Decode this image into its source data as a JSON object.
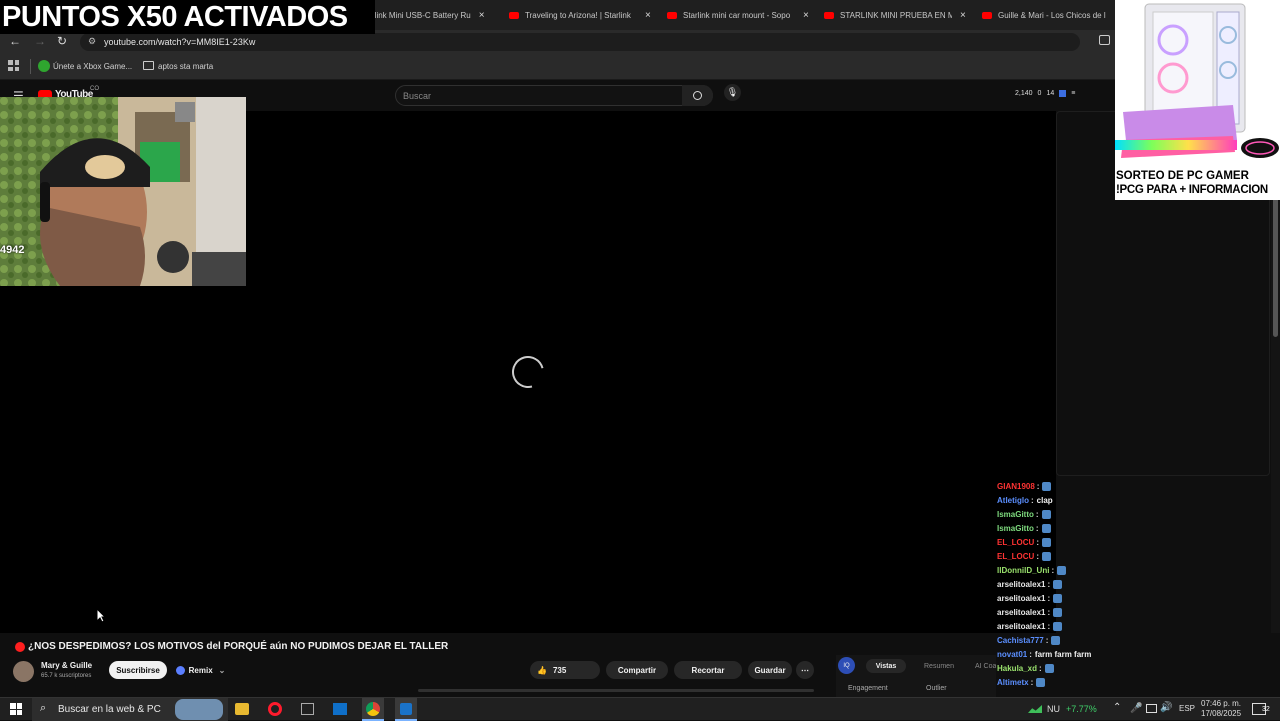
{
  "overlay": {
    "title": "PUNTOS X50 ACTIVADOS"
  },
  "tabs": [
    {
      "label": "rlink Mini USB-C Battery Ru"
    },
    {
      "label": "Traveling to Arizona! | Starlink"
    },
    {
      "label": "Starlink mini car mount - Sopo"
    },
    {
      "label": "STARLINK MINI PRUEBA EN MC"
    },
    {
      "label": "Guille & Mari - Los Chicos de l"
    }
  ],
  "toolbar": {
    "url": "youtube.com/watch?v=MM8IE1-23Kw"
  },
  "bookmarks": [
    {
      "label": "Únete a Xbox Game..."
    },
    {
      "label": "aptos sta marta"
    }
  ],
  "youtube": {
    "logo": "YouTube",
    "logo_sup": "CO",
    "search_placeholder": "Buscar",
    "stats": {
      "points": "2,140",
      "zero": "0",
      "fourteen": "14"
    }
  },
  "webcam": {
    "overlay_number": "4942"
  },
  "video": {
    "title": "¿NOS DESPEDIMOS? LOS MOTIVOS del PORQUÉ aún NO PUDIMOS DEJAR EL TALLER",
    "channel": "Mary & Guille",
    "subscribers": "65.7 k suscriptores",
    "subscribe_label": "Suscribirse",
    "remix_label": "Remix",
    "likes": "735",
    "share_label": "Compartir",
    "clip_label": "Recortar",
    "save_label": "Guardar"
  },
  "ext_panel": {
    "tabs": [
      "Vistas",
      "Resumen",
      "AI Coa"
    ],
    "labels": [
      "Engagement",
      "Outlier"
    ]
  },
  "chat": [
    {
      "user": "GIAN1908",
      "msg": "",
      "color": "#ff3333"
    },
    {
      "user": "Atletiglo",
      "msg": "clap",
      "color": "#5b8fff"
    },
    {
      "user": "IsmaGitto",
      "msg": "",
      "color": "#7fdc7f"
    },
    {
      "user": "IsmaGitto",
      "msg": "",
      "color": "#7fdc7f"
    },
    {
      "user": "EL_LOCU",
      "msg": "",
      "color": "#ff3333"
    },
    {
      "user": "EL_LOCU",
      "msg": "",
      "color": "#ff3333"
    },
    {
      "user": "llDonnilD_Uni",
      "msg": "",
      "color": "#9be36e"
    },
    {
      "user": "arselitoalex1",
      "msg": "",
      "color": "#e8e8e8"
    },
    {
      "user": "arselitoalex1",
      "msg": "",
      "color": "#e8e8e8"
    },
    {
      "user": "arselitoalex1",
      "msg": "",
      "color": "#e8e8e8"
    },
    {
      "user": "arselitoalex1",
      "msg": "",
      "color": "#e8e8e8"
    },
    {
      "user": "Cachista777",
      "msg": "",
      "color": "#5b8fff"
    },
    {
      "user": "novat01",
      "msg": "farm farm farm",
      "color": "#5b8fff"
    },
    {
      "user": "Hakula_xd",
      "msg": "",
      "color": "#9be36e"
    },
    {
      "user": "Altimetx",
      "msg": "",
      "color": "#5b8fff"
    }
  ],
  "pc_ad": {
    "line1": "SORTEO DE PC GAMER",
    "line2": "!PCG PARA + INFORMACION"
  },
  "taskbar": {
    "search_placeholder": "Buscar en la web & PC",
    "weather_label": "NU",
    "stock": "+7.77%",
    "language": "ESP",
    "time": "07:46 p. m.",
    "date": "17/08/2025",
    "notif_count": "32"
  }
}
